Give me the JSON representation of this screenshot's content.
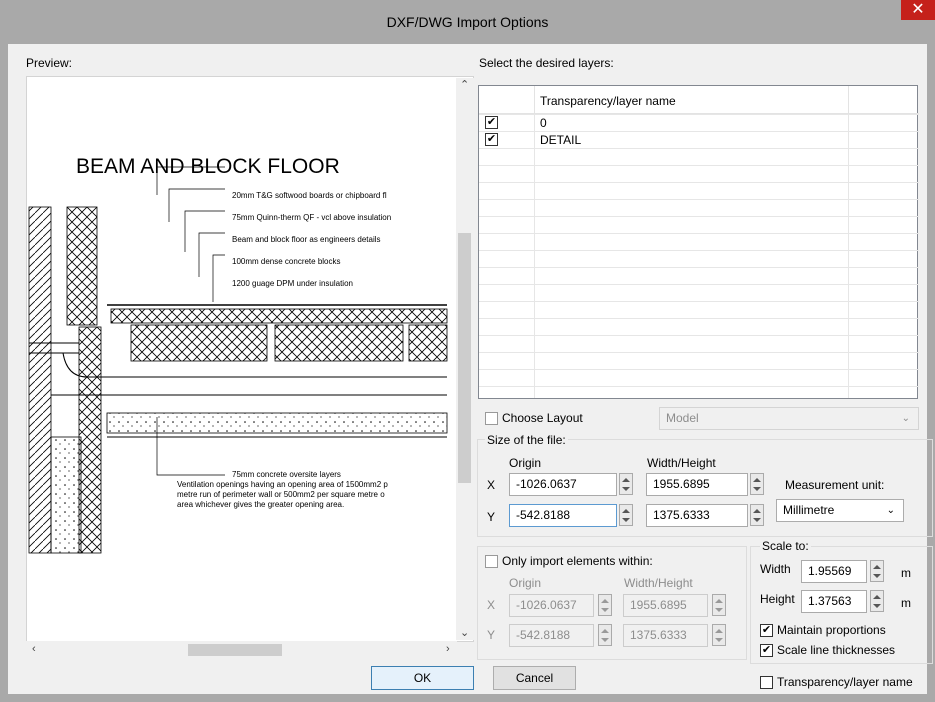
{
  "window": {
    "title": "DXF/DWG Import Options",
    "close_glyph": "✕"
  },
  "preview": {
    "label": "Preview:",
    "drawing_title": "BEAM AND BLOCK FLOOR",
    "annotations": [
      "20mm T&G softwood boards or chipboard fl",
      "75mm Quinn-therm QF - vcl above insulation",
      "Beam and block floor as engineers details",
      "100mm dense concrete blocks",
      "1200 guage DPM under insulation"
    ],
    "bottom_note": [
      "75mm concrete oversite layers",
      "Ventilation openings having an opening area of 1500mm2 p",
      "metre run of perimeter wall or 500mm2 per square metre o",
      "area whichever gives the greater opening area."
    ]
  },
  "layers": {
    "label": "Select the desired layers:",
    "column_header": "Transparency/layer name",
    "rows": [
      {
        "checked": "✔",
        "name": "0"
      },
      {
        "checked": "✔",
        "name": "DETAIL"
      }
    ]
  },
  "layout": {
    "label": "Choose Layout",
    "value": "Model"
  },
  "size": {
    "group_label": "Size of the file:",
    "origin_label": "Origin",
    "wh_label": "Width/Height",
    "x_label": "X",
    "y_label": "Y",
    "origin_x": "-1026.0637",
    "origin_y": "-542.8188",
    "width": "1955.6895",
    "height": "1375.6333",
    "unit_label": "Measurement unit:",
    "unit_value": "Millimetre"
  },
  "within": {
    "label": "Only import elements within:",
    "origin_label": "Origin",
    "wh_label": "Width/Height",
    "x_label": "X",
    "y_label": "Y",
    "origin_x": "-1026.0637",
    "origin_y": "-542.8188",
    "width": "1955.6895",
    "height": "1375.6333"
  },
  "scale": {
    "label": "Scale to:",
    "width_label": "Width",
    "width_value": "1.95569",
    "height_label": "Height",
    "height_value": "1.37563",
    "unit": "m",
    "maintain_label": "Maintain proportions",
    "maintain_checked": "✔",
    "scale_lines_label": "Scale line thicknesses",
    "scale_lines_checked": "✔"
  },
  "buttons": {
    "ok": "OK",
    "cancel": "Cancel"
  },
  "bottom_checkbox": {
    "label": "Transparency/layer name"
  }
}
